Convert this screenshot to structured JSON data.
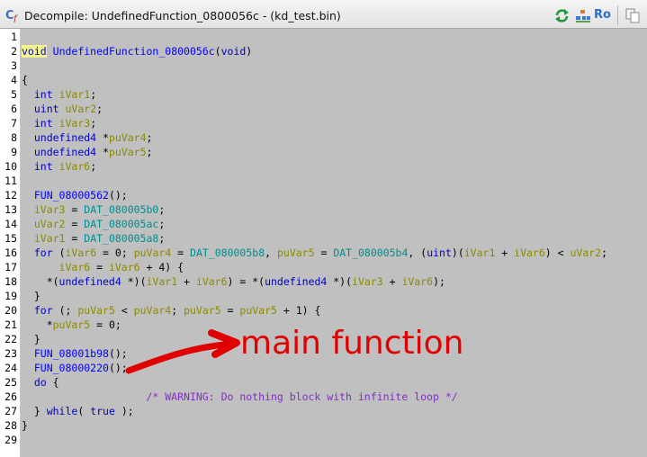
{
  "window": {
    "title": "Decompile: UndefinedFunction_0800056c - (kd_test.bin)",
    "icon": "decompiler-icon",
    "toolbar": {
      "refresh_icon": "refresh-icon",
      "grid_icon": "grid-icon",
      "read_only_label": "Ro",
      "copy_icon": "copy-icon"
    }
  },
  "code_lines": [
    {
      "n": "1",
      "t": ""
    },
    {
      "n": "2",
      "t": "void UndefinedFunction_0800056c(void)"
    },
    {
      "n": "3",
      "t": ""
    },
    {
      "n": "4",
      "t": "{"
    },
    {
      "n": "5",
      "t": "  int iVar1;"
    },
    {
      "n": "6",
      "t": "  uint uVar2;"
    },
    {
      "n": "7",
      "t": "  int iVar3;"
    },
    {
      "n": "8",
      "t": "  undefined4 *puVar4;"
    },
    {
      "n": "9",
      "t": "  undefined4 *puVar5;"
    },
    {
      "n": "10",
      "t": "  int iVar6;"
    },
    {
      "n": "11",
      "t": ""
    },
    {
      "n": "12",
      "t": "  FUN_08000562();"
    },
    {
      "n": "13",
      "t": "  iVar3 = DAT_080005b0;"
    },
    {
      "n": "14",
      "t": "  uVar2 = DAT_080005ac;"
    },
    {
      "n": "15",
      "t": "  iVar1 = DAT_080005a8;"
    },
    {
      "n": "16",
      "t": "  for (iVar6 = 0; puVar4 = DAT_080005b8, puVar5 = DAT_080005b4, (uint)(iVar1 + iVar6) < uVar2;"
    },
    {
      "n": "17",
      "t": "      iVar6 = iVar6 + 4) {"
    },
    {
      "n": "18",
      "t": "    *(undefined4 *)(iVar1 + iVar6) = *(undefined4 *)(iVar3 + iVar6);"
    },
    {
      "n": "19",
      "t": "  }"
    },
    {
      "n": "20",
      "t": "  for (; puVar5 < puVar4; puVar5 = puVar5 + 1) {"
    },
    {
      "n": "21",
      "t": "    *puVar5 = 0;"
    },
    {
      "n": "22",
      "t": "  }"
    },
    {
      "n": "23",
      "t": "  FUN_08001b98();"
    },
    {
      "n": "24",
      "t": "  FUN_08000220();"
    },
    {
      "n": "25",
      "t": "  do {"
    },
    {
      "n": "26",
      "t": "                    /* WARNING: Do nothing block with infinite loop */"
    },
    {
      "n": "27",
      "t": "  } while( true );"
    },
    {
      "n": "28",
      "t": "}"
    },
    {
      "n": "29",
      "t": ""
    }
  ],
  "annotation": {
    "label": "main function",
    "color": "#e00000"
  },
  "colors": {
    "keyword": "#0000c0",
    "function": "#0000ff",
    "local_variable": "#8a8a00",
    "global_data": "#008c8c",
    "comment": "#8030c0",
    "highlight": "#f4f48c",
    "code_background": "#c0c0c0"
  }
}
